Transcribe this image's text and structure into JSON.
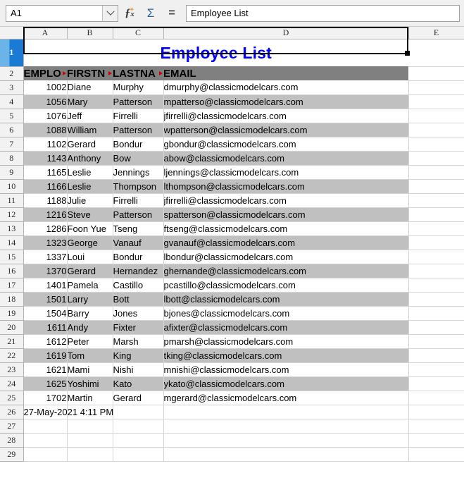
{
  "app": "LibreOffice Calc",
  "formula_bar": {
    "name_box_value": "A1",
    "name_box_dropdown_icon": "chevron-down-icon",
    "function_wizard_icon": "fx-icon",
    "sum_icon": "sum-sigma-icon",
    "formula_icon": "equals-icon",
    "input_line_value": "Employee List"
  },
  "grid": {
    "column_headers": [
      "A",
      "B",
      "C",
      "D",
      "E"
    ],
    "selected_column": "A",
    "selected_row": "1",
    "row_numbers": [
      "1",
      "2",
      "3",
      "4",
      "5",
      "6",
      "7",
      "8",
      "9",
      "10",
      "11",
      "12",
      "13",
      "14",
      "15",
      "16",
      "17",
      "18",
      "19",
      "20",
      "21",
      "22",
      "23",
      "24",
      "25",
      "26",
      "27",
      "28",
      "29"
    ],
    "title_row": {
      "row": "1",
      "text": "Employee List",
      "color": "#0000ff",
      "merged_range": "A1:D1"
    },
    "header_row": {
      "row": "2",
      "background": "#808080",
      "cells": [
        {
          "col": "A",
          "text": "EMPLO",
          "truncated": true
        },
        {
          "col": "B",
          "text": "FIRSTN",
          "truncated": true
        },
        {
          "col": "C",
          "text": "LASTNA",
          "truncated": true
        },
        {
          "col": "D",
          "text": "EMAIL",
          "truncated": false
        }
      ]
    },
    "columns": [
      "EMPLOYEENUMBER",
      "FIRSTNAME",
      "LASTNAME",
      "EMAIL"
    ],
    "rows": [
      {
        "row": "3",
        "a": "1002",
        "b": "Diane",
        "c": "Murphy",
        "d": "dmurphy@classicmodelcars.com"
      },
      {
        "row": "4",
        "a": "1056",
        "b": "Mary",
        "c": "Patterson",
        "d": "mpatterso@classicmodelcars.com"
      },
      {
        "row": "5",
        "a": "1076",
        "b": "Jeff",
        "c": "Firrelli",
        "d": "jfirrelli@classicmodelcars.com"
      },
      {
        "row": "6",
        "a": "1088",
        "b": "William",
        "c": "Patterson",
        "d": "wpatterson@classicmodelcars.com"
      },
      {
        "row": "7",
        "a": "1102",
        "b": "Gerard",
        "c": "Bondur",
        "d": "gbondur@classicmodelcars.com"
      },
      {
        "row": "8",
        "a": "1143",
        "b": "Anthony",
        "c": "Bow",
        "d": "abow@classicmodelcars.com"
      },
      {
        "row": "9",
        "a": "1165",
        "b": "Leslie",
        "c": "Jennings",
        "d": "ljennings@classicmodelcars.com"
      },
      {
        "row": "10",
        "a": "1166",
        "b": "Leslie",
        "c": "Thompson",
        "d": "lthompson@classicmodelcars.com"
      },
      {
        "row": "11",
        "a": "1188",
        "b": "Julie",
        "c": "Firrelli",
        "d": "jfirrelli@classicmodelcars.com"
      },
      {
        "row": "12",
        "a": "1216",
        "b": "Steve",
        "c": "Patterson",
        "d": "spatterson@classicmodelcars.com"
      },
      {
        "row": "13",
        "a": "1286",
        "b": "Foon Yue",
        "c": "Tseng",
        "d": "ftseng@classicmodelcars.com"
      },
      {
        "row": "14",
        "a": "1323",
        "b": "George",
        "c": "Vanauf",
        "d": "gvanauf@classicmodelcars.com"
      },
      {
        "row": "15",
        "a": "1337",
        "b": "Loui",
        "c": "Bondur",
        "d": "lbondur@classicmodelcars.com"
      },
      {
        "row": "16",
        "a": "1370",
        "b": "Gerard",
        "c": "Hernandez",
        "d": "ghernande@classicmodelcars.com"
      },
      {
        "row": "17",
        "a": "1401",
        "b": "Pamela",
        "c": "Castillo",
        "d": "pcastillo@classicmodelcars.com"
      },
      {
        "row": "18",
        "a": "1501",
        "b": "Larry",
        "c": "Bott",
        "d": "lbott@classicmodelcars.com"
      },
      {
        "row": "19",
        "a": "1504",
        "b": "Barry",
        "c": "Jones",
        "d": "bjones@classicmodelcars.com"
      },
      {
        "row": "20",
        "a": "1611",
        "b": "Andy",
        "c": "Fixter",
        "d": "afixter@classicmodelcars.com"
      },
      {
        "row": "21",
        "a": "1612",
        "b": "Peter",
        "c": "Marsh",
        "d": "pmarsh@classicmodelcars.com"
      },
      {
        "row": "22",
        "a": "1619",
        "b": "Tom",
        "c": "King",
        "d": "tking@classicmodelcars.com"
      },
      {
        "row": "23",
        "a": "1621",
        "b": "Mami",
        "c": "Nishi",
        "d": "mnishi@classicmodelcars.com"
      },
      {
        "row": "24",
        "a": "1625",
        "b": "Yoshimi",
        "c": "Kato",
        "d": "ykato@classicmodelcars.com"
      },
      {
        "row": "25",
        "a": "1702",
        "b": "Martin",
        "c": "Gerard",
        "d": "mgerard@classicmodelcars.com"
      }
    ],
    "timestamp_row": {
      "row": "26",
      "value": "27-May-2021 4:11 PM"
    },
    "empty_rows": [
      "27",
      "28",
      "29"
    ]
  }
}
